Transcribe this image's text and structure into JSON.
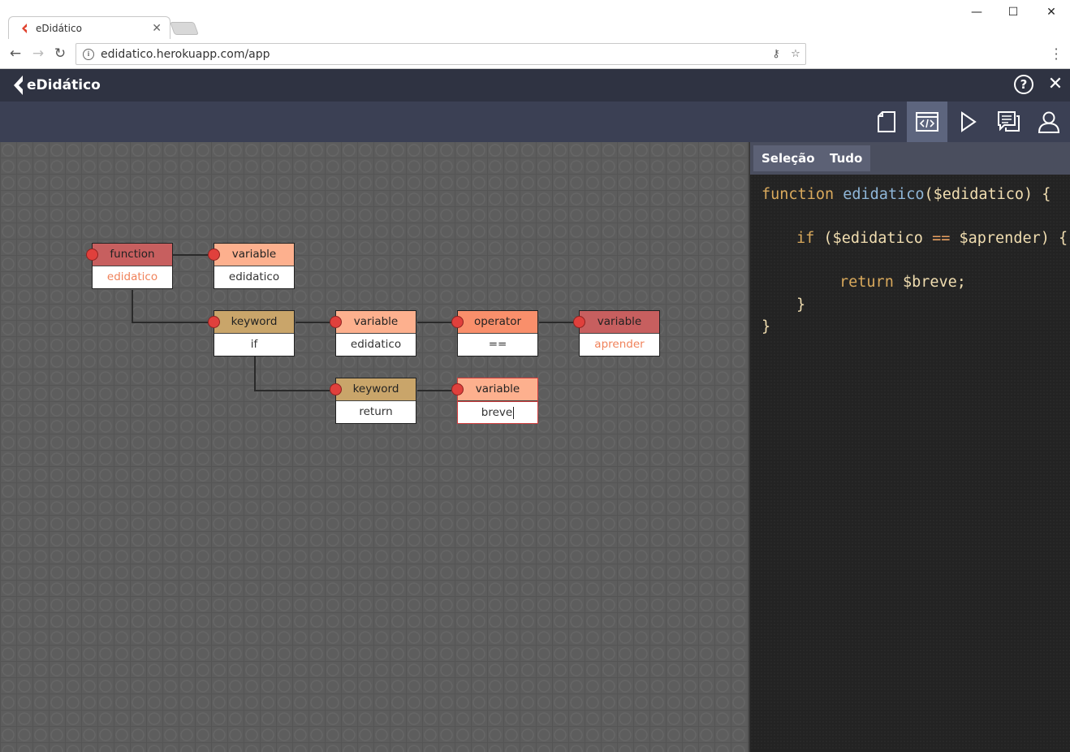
{
  "browser": {
    "tab_title": "eDidático",
    "url": "edidatico.herokuapp.com/app",
    "window_controls": {
      "minimize": "—",
      "maximize": "☐",
      "close": "✕"
    },
    "nav": {
      "back": "←",
      "forward": "→",
      "reload": "↻"
    }
  },
  "app": {
    "logo_text": "eDidático",
    "help_label": "?",
    "close_label": "✕",
    "toolbar_icons": [
      "page-icon",
      "code-window-icon",
      "play-icon",
      "chat-icon",
      "user-icon"
    ],
    "active_tool": "code-window-icon"
  },
  "nodes": [
    {
      "id": "n1",
      "type": "function",
      "label": "function",
      "value": "edidatico",
      "accent": true
    },
    {
      "id": "n2",
      "type": "variable",
      "label": "variable",
      "value": "edidatico",
      "accent": false
    },
    {
      "id": "n3",
      "type": "keyword",
      "label": "keyword",
      "value": "if",
      "accent": false
    },
    {
      "id": "n4",
      "type": "variable",
      "label": "variable",
      "value": "edidatico",
      "accent": false
    },
    {
      "id": "n5",
      "type": "operator",
      "label": "operator",
      "value": "==",
      "accent": false
    },
    {
      "id": "n6",
      "type": "variable",
      "label": "variable",
      "value": "aprender",
      "accent": true
    },
    {
      "id": "n7",
      "type": "keyword",
      "label": "keyword",
      "value": "return",
      "accent": false
    },
    {
      "id": "n8",
      "type": "variable",
      "label": "variable",
      "value": "breve",
      "accent": false,
      "editing": true
    }
  ],
  "code_panel": {
    "tabs": [
      {
        "label": "Seleção",
        "active": true
      },
      {
        "label": "Tudo",
        "active": false
      }
    ],
    "lines": [
      {
        "indent": 0,
        "tokens": [
          {
            "t": "kw",
            "v": "function "
          },
          {
            "t": "fn",
            "v": "edidatico"
          },
          {
            "t": "vr",
            "v": "($edidatico) {"
          }
        ]
      },
      {
        "indent": 1,
        "tokens": [
          {
            "t": "kw",
            "v": "if "
          },
          {
            "t": "vr",
            "v": "($edidatico "
          },
          {
            "t": "op",
            "v": "=="
          },
          {
            "t": "vr",
            "v": " $aprender) {"
          }
        ]
      },
      {
        "indent": 2,
        "tokens": [
          {
            "t": "kw",
            "v": "return "
          },
          {
            "t": "vr",
            "v": "$breve;"
          }
        ]
      },
      {
        "indent": 1,
        "tokens": [
          {
            "t": "vr",
            "v": "}"
          }
        ]
      },
      {
        "indent": 0,
        "tokens": [
          {
            "t": "vr",
            "v": "}"
          }
        ]
      }
    ]
  },
  "colors": {
    "header": "#2f3342",
    "toolbar": "#3b4054",
    "active_tool": "#5d657e",
    "port": "#e0403c",
    "function": "#c75f5f",
    "variable": "#fdb08e",
    "keyword": "#c9a56a",
    "operator": "#f98f6b"
  }
}
